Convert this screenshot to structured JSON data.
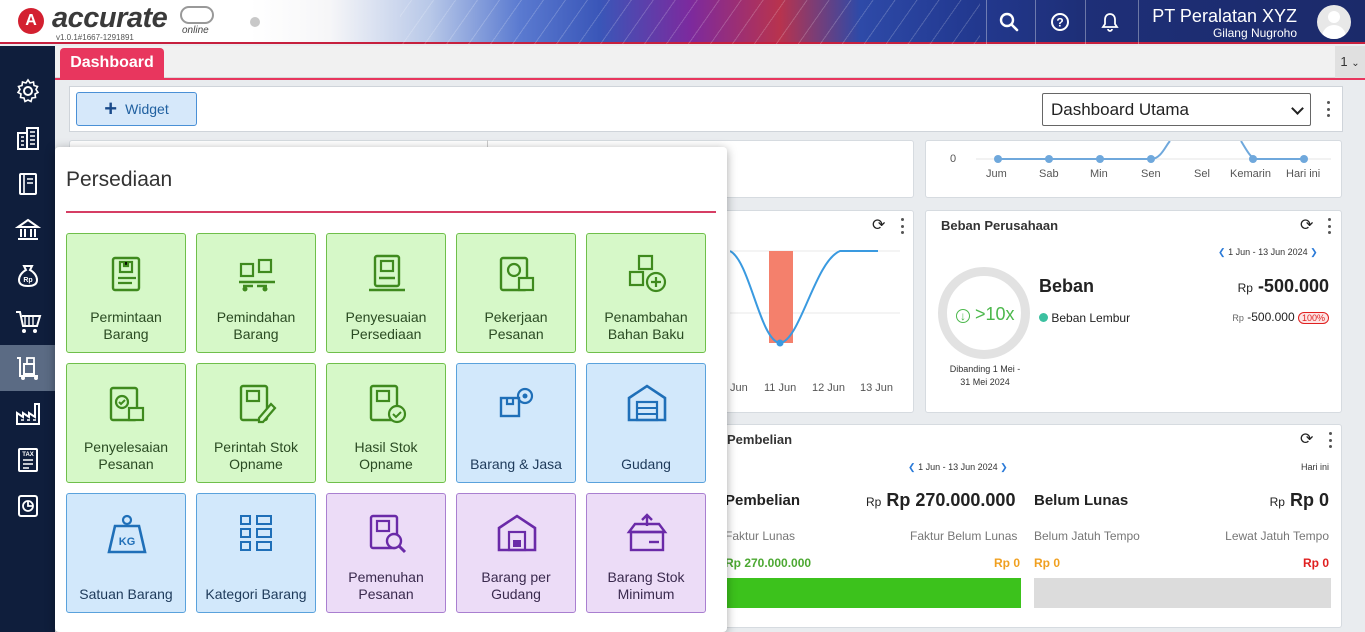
{
  "app": {
    "logo_mark": "A",
    "logo_text": "accurate",
    "logo_sub": "online",
    "version": "v1.0.1#1667-1291891",
    "company": "PT Peralatan XYZ",
    "user": "Gilang Nugroho"
  },
  "tabs": {
    "active": "Dashboard",
    "count": "1"
  },
  "toolbar": {
    "widget_label": "Widget",
    "dashboard_select": "Dashboard Utama"
  },
  "sidebar": {
    "items": [
      {
        "icon": "settings-icon"
      },
      {
        "icon": "company-building-icon"
      },
      {
        "icon": "ledger-book-icon"
      },
      {
        "icon": "bank-icon"
      },
      {
        "icon": "money-bag-icon"
      },
      {
        "icon": "shopping-cart-icon"
      },
      {
        "icon": "inventory-cart-icon",
        "active": true
      },
      {
        "icon": "factory-icon"
      },
      {
        "icon": "tax-document-icon"
      },
      {
        "icon": "report-chart-icon"
      }
    ]
  },
  "chart_top": {
    "y_tick": "0",
    "x_labels": [
      "Jum",
      "Sab",
      "Min",
      "Sen",
      "Sel",
      "Kemarin",
      "Hari ini"
    ]
  },
  "chart_mid": {
    "x_labels": [
      "Jun",
      "11 Jun",
      "12 Jun",
      "13 Jun"
    ]
  },
  "beban": {
    "title": "Beban Perusahaan",
    "period": "1 Jun - 13 Jun 2024",
    "ratio": ">10x",
    "label": "Beban",
    "currency": "Rp",
    "total": "-500.000",
    "item_name": "Beban Lembur",
    "item_value": "-500.000",
    "item_pct": "100%",
    "compare_line1": "Dibanding 1 Mei -",
    "compare_line2": "31 Mei 2024"
  },
  "pembelian": {
    "title": "Pembelian",
    "period": "1 Jun - 13 Jun 2024",
    "today": "Hari ini",
    "label": "Pembelian",
    "currency": "Rp",
    "total": "Rp 270.000.000",
    "unpaid_label": "Belum Lunas",
    "unpaid_total": "Rp 0",
    "paid_label": "Faktur Lunas",
    "paid_value": "Rp 270.000.000",
    "unpaid_inv_label": "Faktur Belum Lunas",
    "unpaid_inv_value": "Rp 0",
    "not_due_label": "Belum Jatuh Tempo",
    "not_due_value": "Rp 0",
    "overdue_label": "Lewat Jatuh Tempo",
    "overdue_value": "Rp 0",
    "paid_fraction": 1.0,
    "colors": {
      "paid": "#3cc21c",
      "neutral": "#dcdcdc",
      "overdue": "#e02020",
      "warn": "#f0a020"
    }
  },
  "popup": {
    "title": "Persediaan",
    "tiles": [
      {
        "l1": "Permintaan",
        "l2": "Barang",
        "color": "green",
        "icon": "item-request-icon"
      },
      {
        "l1": "Pemindahan",
        "l2": "Barang",
        "color": "green",
        "icon": "forklift-transfer-icon"
      },
      {
        "l1": "Penyesuaian",
        "l2": "Persediaan",
        "color": "green",
        "icon": "stock-adjustment-icon"
      },
      {
        "l1": "Pekerjaan",
        "l2": "Pesanan",
        "color": "green",
        "icon": "work-order-icon"
      },
      {
        "l1": "Penambahan",
        "l2": "Bahan Baku",
        "color": "green",
        "icon": "add-material-icon"
      },
      {
        "l1": "Penyelesaian",
        "l2": "Pesanan",
        "color": "green",
        "icon": "order-completion-icon"
      },
      {
        "l1": "Perintah Stok",
        "l2": "Opname",
        "color": "green",
        "icon": "stock-opname-order-icon"
      },
      {
        "l1": "Hasil Stok",
        "l2": "Opname",
        "color": "green",
        "icon": "stock-opname-result-icon"
      },
      {
        "l1": "Barang & Jasa",
        "l2": "",
        "color": "blue",
        "icon": "goods-services-icon"
      },
      {
        "l1": "Gudang",
        "l2": "",
        "color": "blue",
        "icon": "warehouse-icon"
      },
      {
        "l1": "Satuan Barang",
        "l2": "",
        "color": "blue",
        "icon": "kg-weight-icon"
      },
      {
        "l1": "Kategori Barang",
        "l2": "",
        "color": "blue",
        "icon": "category-grid-icon"
      },
      {
        "l1": "Pemenuhan",
        "l2": "Pesanan",
        "color": "purple",
        "icon": "order-fulfillment-icon"
      },
      {
        "l1": "Barang per",
        "l2": "Gudang",
        "color": "purple",
        "icon": "goods-per-warehouse-icon"
      },
      {
        "l1": "Barang Stok",
        "l2": "Minimum",
        "color": "purple",
        "icon": "minimum-stock-icon"
      }
    ]
  }
}
